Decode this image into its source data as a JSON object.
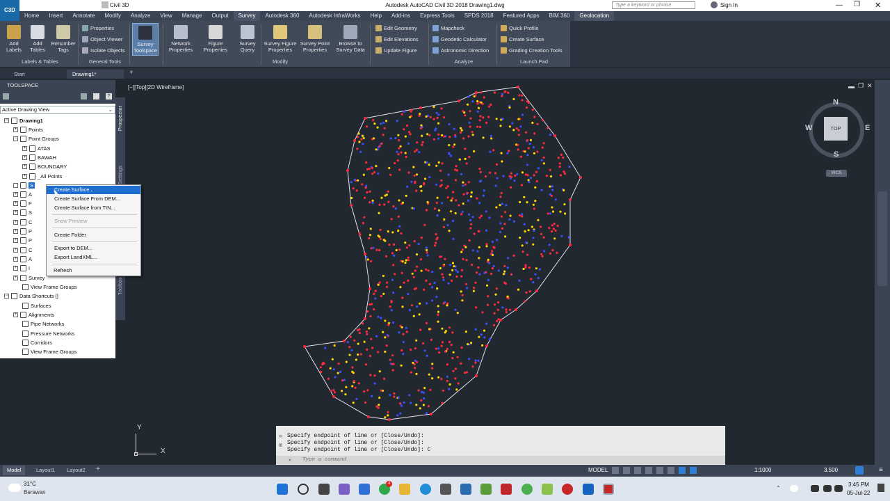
{
  "window": {
    "title": "Autodesk AutoCAD Civil 3D 2018    Drawing1.dwg",
    "workspace": "Civil 3D",
    "search_placeholder": "Type a keyword or phrase",
    "sign_in": "Sign In"
  },
  "app_button": "C3D",
  "menu_tabs": [
    "Home",
    "Insert",
    "Annotate",
    "Modify",
    "Analyze",
    "View",
    "Manage",
    "Output",
    "Survey",
    "Autodesk 360",
    "Autodesk InfraWorks",
    "Help",
    "Add-ins",
    "Express Tools",
    "SPDS 2018",
    "Featured Apps",
    "BIM 360",
    "Geolocation"
  ],
  "active_tab": "Survey",
  "ribbon": {
    "add_labels": "Add Labels",
    "add_tables": "Add Tables",
    "renumber_tags": "Renumber Tags",
    "properties": "Properties",
    "object_viewer": "Object Viewer",
    "isolate_objects": "Isolate Objects",
    "survey_toolspace": "Survey Toolspace",
    "network_properties": "Network Properties",
    "figure_properties": "Figure Properties",
    "survey_query": "Survey Query",
    "survey_figure_properties": "Survey Figure Properties",
    "survey_point_properties": "Survey Point Properties",
    "browse_survey_data": "Browse to Survey Data",
    "edit_geometry": "Edit Geometry",
    "edit_elevations": "Edit Elevations",
    "update_figure": "Update Figure",
    "mapcheck": "Mapcheck",
    "geodetic_calculator": "Geodetic Calculator",
    "astronomic_direction": "Astronomic Direction",
    "quick_profile": "Quick Profile",
    "create_surface": "Create Surface",
    "grading_creation_tools": "Grading Creation Tools",
    "panels": {
      "labels_tables": "Labels & Tables",
      "general_tools": "General Tools",
      "modify": "Modify",
      "analyze": "Analyze",
      "launch_pad": "Launch Pad"
    }
  },
  "doc_tabs": [
    "Start",
    "Drawing1*"
  ],
  "toolspace": {
    "title": "TOOLSPACE",
    "view": "Active Drawing View",
    "side_tabs": [
      "Prospector",
      "Settings",
      "Toolbox"
    ],
    "tree": [
      {
        "label": "Drawing1",
        "level": 0
      },
      {
        "label": "Points",
        "level": 1
      },
      {
        "label": "Point Groups",
        "level": 1
      },
      {
        "label": "ATAS",
        "level": 2
      },
      {
        "label": "BAWAH",
        "level": 2
      },
      {
        "label": "BOUNDARY",
        "level": 2
      },
      {
        "label": "_All Points",
        "level": 2
      },
      {
        "label": "S",
        "level": 1
      },
      {
        "label": "A",
        "level": 1
      },
      {
        "label": "F",
        "level": 1
      },
      {
        "label": "S",
        "level": 1
      },
      {
        "label": "C",
        "level": 1
      },
      {
        "label": "P",
        "level": 1
      },
      {
        "label": "P",
        "level": 1
      },
      {
        "label": "C",
        "level": 1
      },
      {
        "label": "A",
        "level": 1
      },
      {
        "label": "I",
        "level": 1
      },
      {
        "label": "Survey",
        "level": 1
      },
      {
        "label": "View Frame Groups",
        "level": 1
      },
      {
        "label": "Data Shortcuts []",
        "level": 0
      },
      {
        "label": "Surfaces",
        "level": 1
      },
      {
        "label": "Alignments",
        "level": 1
      },
      {
        "label": "Pipe Networks",
        "level": 1
      },
      {
        "label": "Pressure Networks",
        "level": 1
      },
      {
        "label": "Corridors",
        "level": 1
      },
      {
        "label": "View Frame Groups",
        "level": 1
      }
    ]
  },
  "context_menu": {
    "items": [
      "Create Surface...",
      "Create Surface From DEM...",
      "Create Surface from TIN...",
      "Show Preview",
      "Create Folder",
      "Export to DEM...",
      "Export LandXML...",
      "Refresh"
    ],
    "highlighted": "Create Surface...",
    "disabled": [
      "Show Preview"
    ]
  },
  "viewport": {
    "label": "[−][Top][2D Wireframe]",
    "viewcube": {
      "top": "TOP",
      "n": "N",
      "s": "S",
      "e": "E",
      "w": "W",
      "wcs": "WCS"
    },
    "ucs": {
      "x": "X",
      "y": "Y"
    }
  },
  "command_line": {
    "lines": [
      "Specify endpoint of line or [Close/Undo]:",
      "Specify endpoint of line or [Close/Undo]:",
      "Specify endpoint of line or [Close/Undo]: C"
    ],
    "placeholder": "Type a command"
  },
  "status": {
    "layouts": [
      "Model",
      "Layout1",
      "Layout2"
    ],
    "model": "MODEL",
    "scale": "1:1000",
    "value": "3.500"
  },
  "taskbar": {
    "weather_temp": "31°C",
    "weather_desc": "Berawan",
    "time": "3:45 PM",
    "date": "05-Jul-22",
    "badge": "4"
  },
  "colors": {
    "accent": "#1f6fd1",
    "ribbon_bg": "#414a59",
    "canvas_bg": "#212830",
    "point_red": "#ff2a3c",
    "point_yellow": "#ffd400",
    "point_blue": "#3a50ff"
  }
}
